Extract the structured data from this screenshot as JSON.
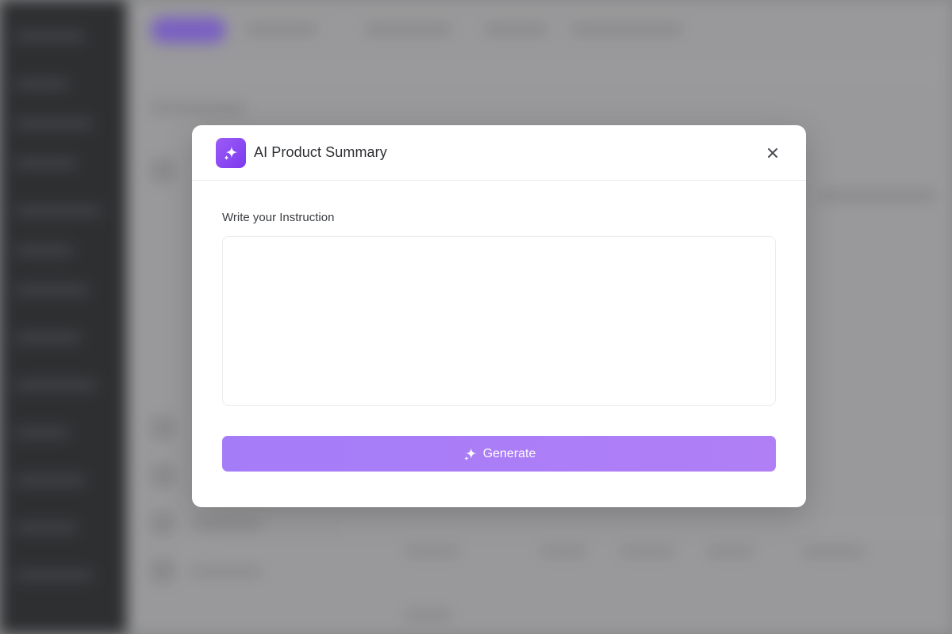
{
  "modal": {
    "title": "AI Product Summary",
    "close_icon": "close-icon",
    "app_icon": "sparkle-icon",
    "instruction_label": "Write your Instruction",
    "instruction_value": "",
    "instruction_placeholder": "",
    "generate_label": "Generate",
    "generate_icon": "sparkle-icon"
  },
  "colors": {
    "accent": "#7c3aed",
    "button": "#a57cf8",
    "backdrop": "#8e8e90"
  }
}
